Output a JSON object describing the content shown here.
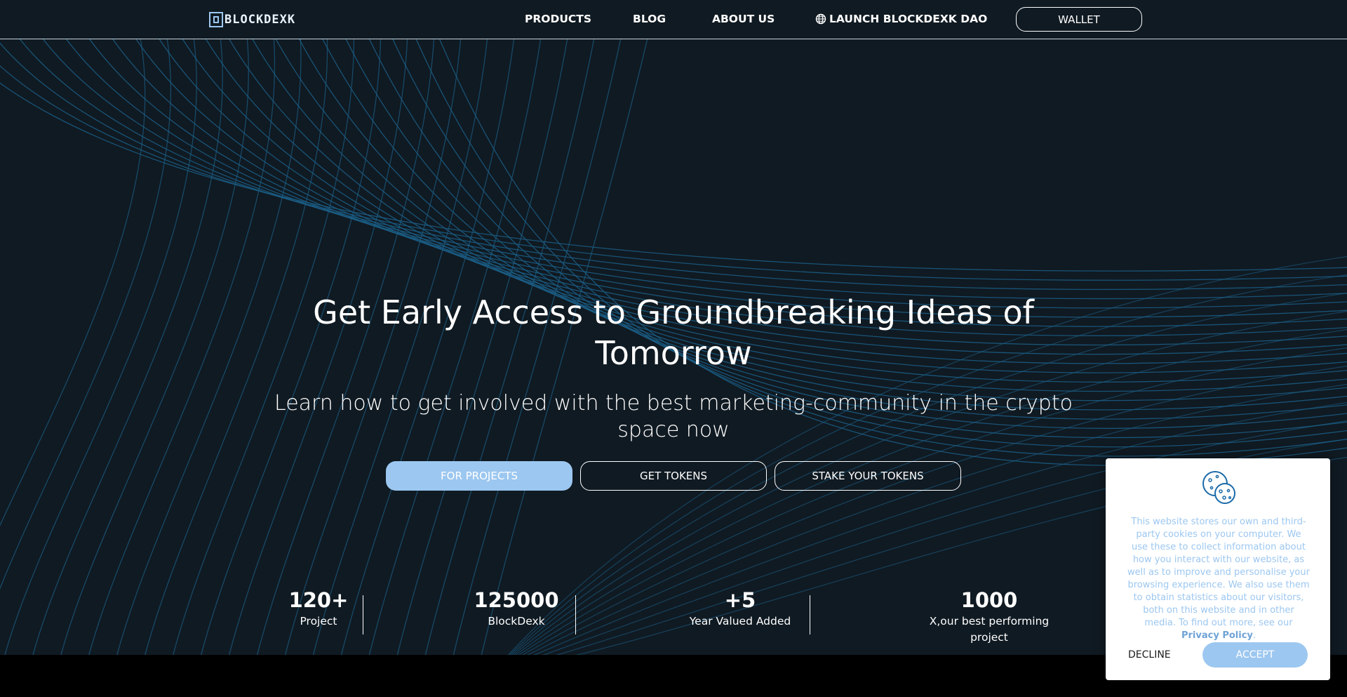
{
  "header": {
    "logo_text": "BLOCKDEXK",
    "nav": [
      {
        "label": "PRODUCTS"
      },
      {
        "label": "BLOG"
      },
      {
        "label": "ABOUT US"
      },
      {
        "label": "LAUNCH BLOCKDEXK DAO",
        "icon": "globe-icon"
      }
    ],
    "wallet_label": "WALLET"
  },
  "hero": {
    "title": "Get Early Access to Groundbreaking Ideas of Tomorrow",
    "subtitle": "Learn how to get involved with the best marketing-community in the crypto space now",
    "buttons": [
      {
        "label": "FOR PROJECTS"
      },
      {
        "label": "GET TOKENS"
      },
      {
        "label": "STAKE YOUR TOKENS"
      }
    ]
  },
  "stats": [
    {
      "value": "120+",
      "label": "Project"
    },
    {
      "value": "125000",
      "label": "BlockDexk"
    },
    {
      "value": "+5",
      "label": "Year Valued Added"
    },
    {
      "value": "1000",
      "label": "X,our best performing project"
    }
  ],
  "cookie": {
    "icon": "cookie-icon",
    "text": "This website stores our own and third-party cookies on your computer. We use these to collect information about how you interact with our website, as well as to improve and personalise your browsing experience. We also use them to obtain statistics about our visitors, both on this website and in other media. To find out more, see our",
    "link_label": "Privacy Policy",
    "decline_label": "DECLINE",
    "accept_label": "ACCEPT"
  },
  "colors": {
    "background": "#101a22",
    "accent": "#9cc7f0",
    "wave_lines": "#1b5e86"
  }
}
